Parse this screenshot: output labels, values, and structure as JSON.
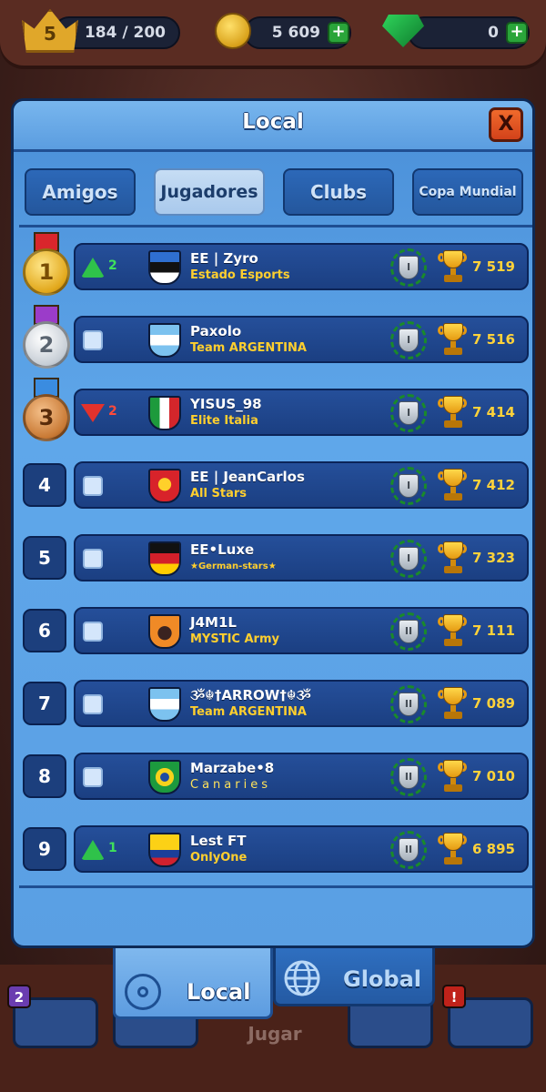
{
  "top_bar": {
    "level": "5",
    "xp": "184 / 200",
    "coins": "5 609",
    "gems": "0",
    "plus": "+"
  },
  "panel": {
    "title": "Local",
    "close": "X"
  },
  "tabs": [
    {
      "label": "Amigos",
      "active": false
    },
    {
      "label": "Jugadores",
      "active": true
    },
    {
      "label": "Clubs",
      "active": false
    },
    {
      "label": "Copa Mundial",
      "active": false
    }
  ],
  "leaderboard": [
    {
      "rank": "1",
      "delta": "up",
      "delta_value": "2",
      "flag": "estonia",
      "name": "EE | Zyro",
      "club": "Estado Esports",
      "league": "I",
      "score": "7 519"
    },
    {
      "rank": "2",
      "delta": "none",
      "delta_value": "",
      "flag": "argentina",
      "name": "Paxolo",
      "club": "Team ARGENTINA",
      "league": "I",
      "score": "7 516"
    },
    {
      "rank": "3",
      "delta": "down",
      "delta_value": "2",
      "flag": "italy",
      "name": "YISUS_98",
      "club": "Elite Italia",
      "league": "I",
      "score": "7 414"
    },
    {
      "rank": "4",
      "delta": "none",
      "delta_value": "",
      "flag": "kyrgyzstan",
      "name": "EE | JeanCarlos",
      "club": "All Stars",
      "league": "I",
      "score": "7 412"
    },
    {
      "rank": "5",
      "delta": "none",
      "delta_value": "",
      "flag": "germany",
      "name": "EE•Luxe",
      "club": "★German-stars★",
      "league": "I",
      "score": "7 323"
    },
    {
      "rank": "6",
      "delta": "none",
      "delta_value": "",
      "flag": "club-bomb",
      "name": "J4M1L",
      "club": "MYSTIC Army",
      "league": "II",
      "score": "7 111"
    },
    {
      "rank": "7",
      "delta": "none",
      "delta_value": "",
      "flag": "argentina",
      "name": "ૐ☬†ARROW†☬ૐ",
      "club": "Team ARGENTINA",
      "league": "II",
      "score": "7 089"
    },
    {
      "rank": "8",
      "delta": "none",
      "delta_value": "",
      "flag": "brazil",
      "name": "Marzabe•8",
      "club": "Canaries",
      "league": "II",
      "score": "7 010"
    },
    {
      "rank": "9",
      "delta": "up",
      "delta_value": "1",
      "flag": "colombia",
      "name": "Lest FT",
      "club": "OnlyOne",
      "league": "II",
      "score": "6 895"
    }
  ],
  "switch": {
    "local": "Local",
    "global": "Global"
  },
  "bottom_nav": {
    "jugar": "Jugar",
    "badge_left": "2",
    "badge_right": "!"
  },
  "colors": {
    "panel_blue": "#5a9fe3",
    "row_blue": "#1b3f82",
    "score_gold": "#ffd23a",
    "club_gold": "#ffcf2e",
    "up_green": "#2fc24a",
    "down_red": "#e2322c",
    "close_orange": "#e0501f"
  }
}
